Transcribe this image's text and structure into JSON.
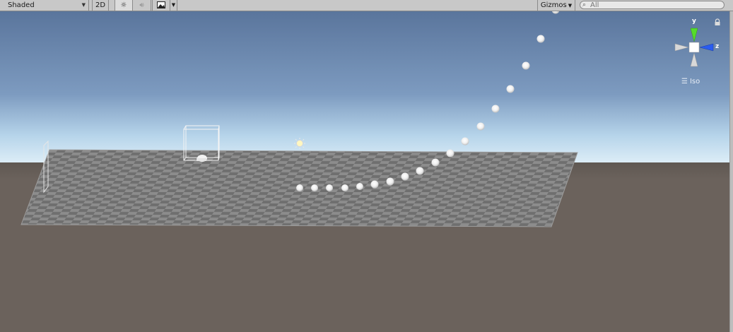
{
  "toolbar": {
    "shading_mode": "Shaded",
    "mode_2d_label": "2D",
    "lighting_icon": "sun-icon",
    "audio_icon": "speaker-icon",
    "effects_icon": "image-icon",
    "gizmos_label": "Gizmos",
    "search_placeholder": "All"
  },
  "scene": {
    "orientation_gizmo": {
      "y_label": "y",
      "z_label": "z",
      "projection_label": "Iso"
    },
    "colors": {
      "sky_top": "#5a759c",
      "sky_horizon": "#d9ecf7",
      "ground": "#6b625c",
      "plane": "#8a8a8a",
      "y_axis": "#55dd2a",
      "z_axis": "#2a5cf0"
    }
  }
}
